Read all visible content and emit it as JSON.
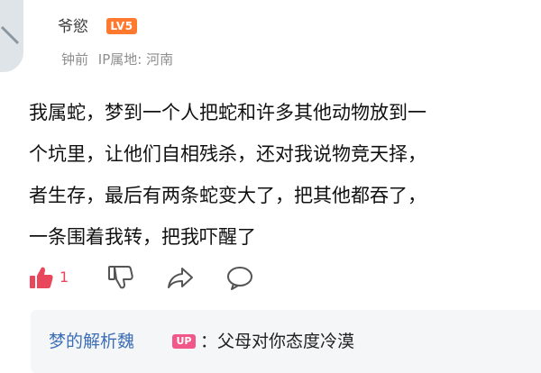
{
  "comment": {
    "username": "爷慾",
    "level_badge": "LV5",
    "time_ago": "钟前",
    "ip_location": "IP属地: 河南",
    "body_lines": [
      "我属蛇，梦到一个人把蛇和许多其他动物放到一",
      "个坑里，让他们自相残杀，还对我说物竞天择，",
      "者生存，最后有两条蛇变大了，把其他都吞了，",
      "一条围着我转，把我吓醒了"
    ],
    "like_count": "1"
  },
  "actions": {
    "like_icon": "thumbs-up-icon",
    "dislike_icon": "thumbs-down-icon",
    "share_icon": "share-icon",
    "reply_icon": "comment-bubble-icon"
  },
  "reply": {
    "author": "梦的解析魏",
    "badge": "UP",
    "text": "：父母对你态度冷漠"
  },
  "colors": {
    "like_active": "#e8475c",
    "level_badge": "#ff7a2f",
    "up_badge": "#f2578a",
    "link_blue": "#3d6fb6",
    "reply_bg": "#f4f6f8"
  }
}
